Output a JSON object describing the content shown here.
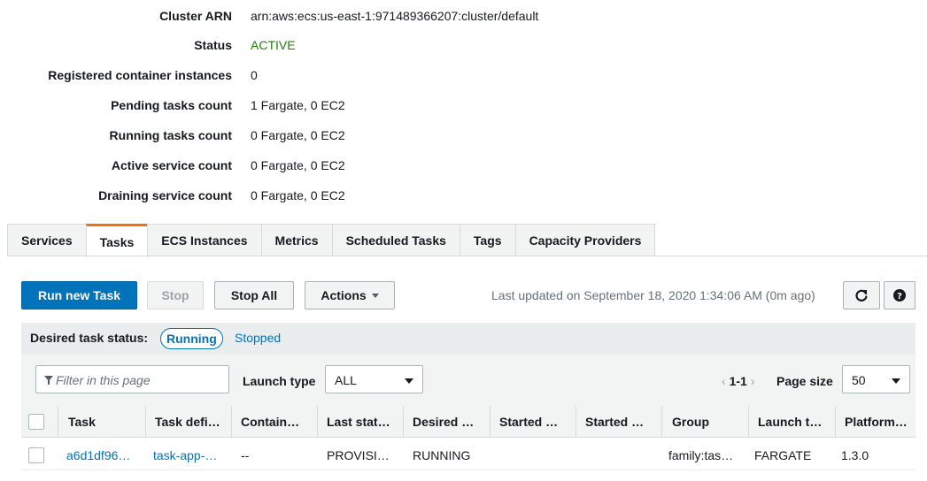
{
  "details": {
    "cluster_arn_label": "Cluster ARN",
    "cluster_arn_value": "arn:aws:ecs:us-east-1:971489366207:cluster/default",
    "status_label": "Status",
    "status_value": "ACTIVE",
    "registered_label": "Registered container instances",
    "registered_value": "0",
    "pending_label": "Pending tasks count",
    "pending_value": "1 Fargate, 0 EC2",
    "running_label": "Running tasks count",
    "running_value": "0 Fargate, 0 EC2",
    "active_service_label": "Active service count",
    "active_service_value": "0 Fargate, 0 EC2",
    "draining_label": "Draining service count",
    "draining_value": "0 Fargate, 0 EC2"
  },
  "tabs": {
    "services": "Services",
    "tasks": "Tasks",
    "ecs_instances": "ECS Instances",
    "metrics": "Metrics",
    "scheduled_tasks": "Scheduled Tasks",
    "tags": "Tags",
    "capacity_providers": "Capacity Providers",
    "active": "Tasks"
  },
  "toolbar": {
    "run_new_task": "Run new Task",
    "stop": "Stop",
    "stop_all": "Stop All",
    "actions": "Actions",
    "last_updated": "Last updated on September 18, 2020 1:34:06 AM (0m ago)",
    "refresh_icon": "refresh-icon",
    "help_icon": "help-icon"
  },
  "status_filter": {
    "label": "Desired task status:",
    "running": "Running",
    "stopped": "Stopped"
  },
  "filter": {
    "placeholder": "Filter in this page",
    "launch_type_label": "Launch type",
    "launch_type_value": "ALL",
    "page_range": "1-1",
    "prev_arrow": "‹",
    "next_arrow": "›",
    "page_size_label": "Page size",
    "page_size_value": "50"
  },
  "table": {
    "columns": [
      "Task",
      "Task defi…",
      "Contain…",
      "Last stat…",
      "Desired …",
      "Started …",
      "Started …",
      "Group",
      "Launch t…",
      "Platform…"
    ],
    "rows": [
      {
        "task": "a6d1df96…",
        "task_definition": "task-app-…",
        "container": "--",
        "last_status": "PROVISI…",
        "desired_status": "RUNNING",
        "started_at": "",
        "started_by": "",
        "group": "family:tas…",
        "launch_type": "FARGATE",
        "platform": "1.3.0"
      }
    ]
  },
  "colors": {
    "primary": "#0073bb",
    "active_status": "#1d8102",
    "tab_accent": "#ec7211"
  }
}
